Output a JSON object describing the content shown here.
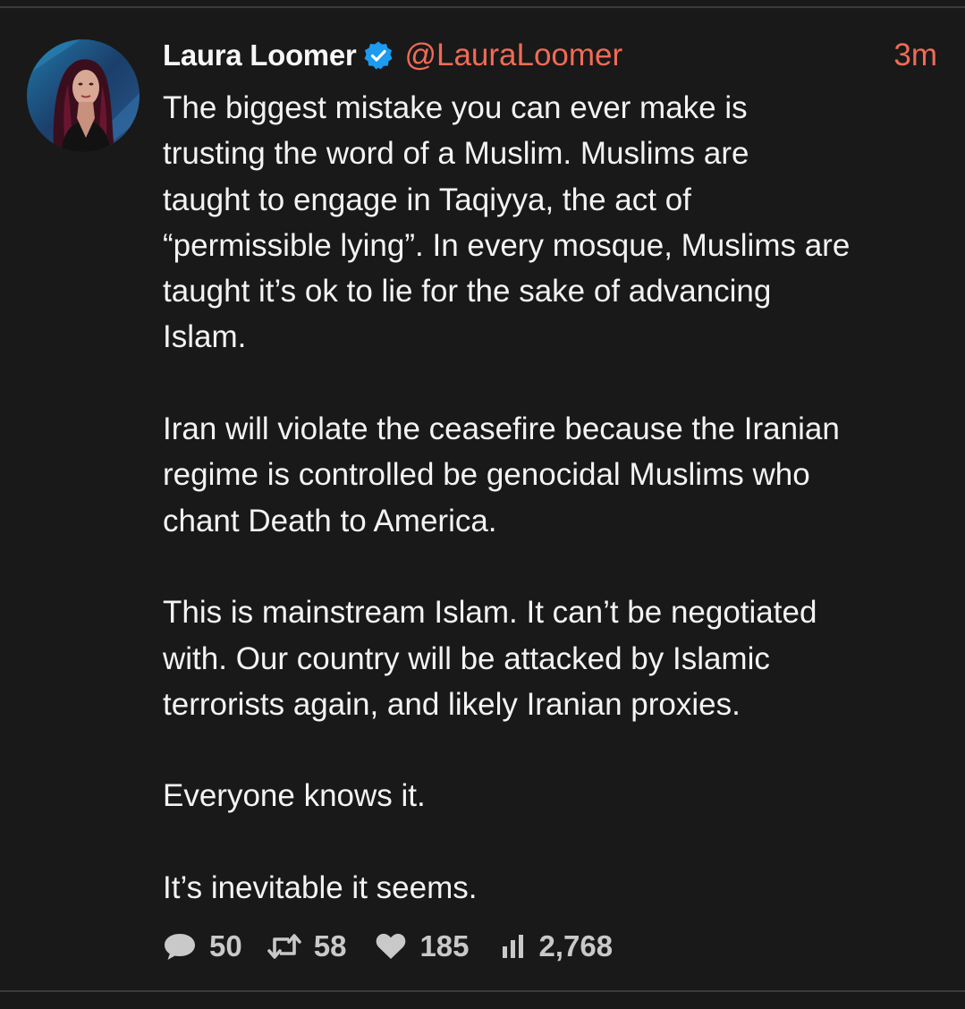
{
  "post": {
    "author": {
      "display_name": "Laura Loomer",
      "handle": "@LauraLoomer",
      "verified": true
    },
    "timestamp": "3m",
    "paragraphs": [
      "The biggest mistake you can ever make is\ntrusting the word of a Muslim. Muslims are\ntaught to engage in Taqiyya, the act of\n“permissible lying”. In every mosque, Muslims are\ntaught it’s ok to lie for the sake of advancing\nIslam.",
      "Iran will violate the ceasefire because the Iranian\nregime is controlled be genocidal Muslims who\nchant Death to America.",
      "This is mainstream Islam. It can’t be negotiated\nwith. Our country will be attacked by Islamic\nterrorists again, and likely Iranian proxies.",
      "Everyone knows it.",
      "It’s inevitable it seems."
    ],
    "stats": {
      "replies": "50",
      "reposts": "58",
      "likes": "185",
      "views": "2,768"
    }
  },
  "icons": {
    "verified": "verified-badge-icon",
    "reply": "speech-bubble-icon",
    "repost": "repost-arrows-icon",
    "like": "heart-icon",
    "views": "bar-chart-icon"
  },
  "colors": {
    "background": "#191919",
    "text": "#f3f3f3",
    "accent": "#f06b55",
    "verified": "#1d9bf0",
    "muted": "#c9c9c9"
  }
}
